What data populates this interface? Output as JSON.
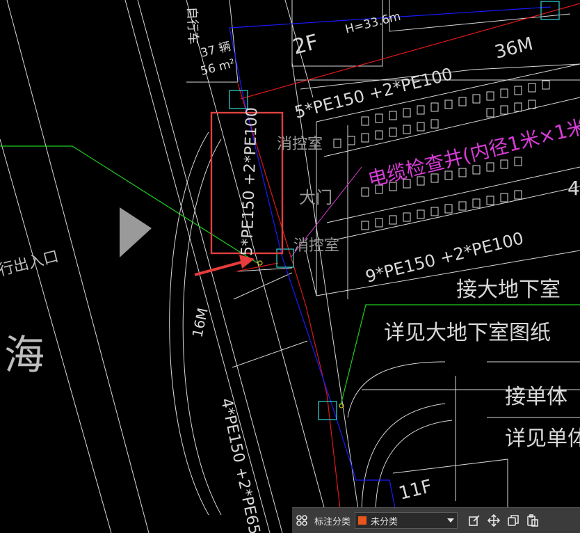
{
  "drawing": {
    "labels": {
      "height_note": "H=33.6m",
      "floor_2f": "2F",
      "width_36m": "36M",
      "pipe_top": "5*PE150 +2*PE100",
      "pipe_highlighted": "5*PE150 +2*PE100",
      "fire_control_upper": "消控室",
      "fire_control_lower": "消控室",
      "lobby": "大门",
      "cable_well": "电缆检查井(内径1米×1米",
      "pipe_middle": "9*PE150 +2*PE100",
      "connect_basement": "接大地下室",
      "see_basement": "详见大地下室图纸",
      "connect_unit": "接单体",
      "see_unit": "详见单体",
      "floor_11f": "11F",
      "road_width": "16M",
      "pipe_left": "4*PE150 +2*PE65",
      "sea_char": "海",
      "exit": "行出入口",
      "side_4": "4",
      "vehicle_1": "37 辆",
      "area_1": "56 m²",
      "vertical_1": "自行车"
    },
    "colors": {
      "background": "#000000",
      "linework": "#d8d8d8",
      "red_line": "#e01818",
      "blue_line": "#1a1aff",
      "green_line": "#1fcc1f",
      "magenta_text": "#d63cd6",
      "cyan_box": "#33d6d6",
      "highlight_box": "#e04040",
      "arrow": "#e83c3c"
    }
  },
  "toolbar": {
    "label": "标注分类",
    "select_value": "未分类",
    "select_swatch_color": "#e8561c",
    "icons": [
      "grid-icon",
      "edit-icon",
      "move-icon",
      "copy-icon",
      "paste-icon"
    ]
  }
}
